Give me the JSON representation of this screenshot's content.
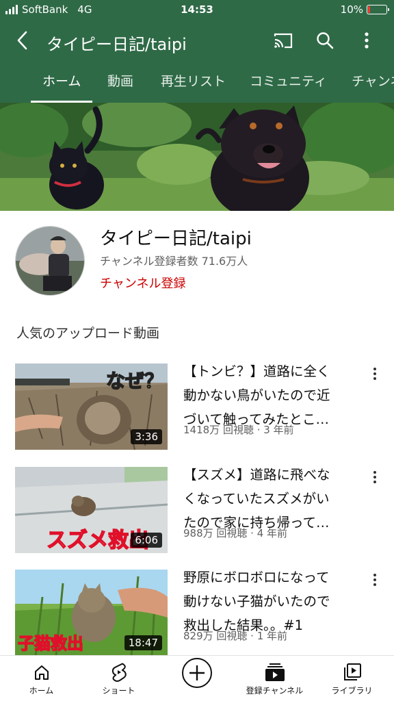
{
  "status_bar": {
    "carrier": "SoftBank",
    "network": "4G",
    "time": "14:53",
    "battery": "10%",
    "battery_color": "#ff3b30"
  },
  "header": {
    "title": "タイピー日記/taipi",
    "back_icon": "chevron-left-icon",
    "cast_icon": "cast-icon",
    "search_icon": "search-icon",
    "more_icon": "more-vert-icon",
    "color": "#2f6a47"
  },
  "tabs": [
    {
      "label": "ホーム",
      "active": true
    },
    {
      "label": "動画",
      "active": false
    },
    {
      "label": "再生リスト",
      "active": false
    },
    {
      "label": "コミュニティ",
      "active": false
    },
    {
      "label": "チャンネル",
      "active": false
    }
  ],
  "channel": {
    "name": "タイピー日記/taipi",
    "subscribers": "チャンネル登録者数 71.6万人",
    "subscribe_label": "チャンネル登録",
    "subscribe_color": "#cc0000"
  },
  "section": {
    "title": "人気のアップロード動画"
  },
  "videos": [
    {
      "title_lines": [
        "【トンビ？】道路に全く",
        "動かない鳥がいたので近",
        "づいて触ってみたとこ…"
      ],
      "meta": "1418万 回視聴 · 3 年前",
      "duration": "3:36",
      "thumb_text": "なぜ？"
    },
    {
      "title_lines": [
        "【スズメ】道路に飛べな",
        "くなっていたスズメがい",
        "たので家に持ち帰って…"
      ],
      "meta": "988万 回視聴 · 4 年前",
      "duration": "6:06",
      "thumb_text": "スズメ救出"
    },
    {
      "title_lines": [
        "野原にボロボロになって",
        "動けない子猫がいたので",
        "救出した結果。。#1"
      ],
      "meta": "829万 回視聴 · 1 年前",
      "duration": "18:47",
      "thumb_text": "子猫救出"
    }
  ],
  "bottom_nav": [
    {
      "label": "ホーム",
      "icon": "home-icon"
    },
    {
      "label": "ショート",
      "icon": "shorts-icon"
    },
    {
      "label": "",
      "icon": "create-plus-icon"
    },
    {
      "label": "登録チャンネル",
      "icon": "subscriptions-icon"
    },
    {
      "label": "ライブラリ",
      "icon": "library-icon"
    }
  ]
}
